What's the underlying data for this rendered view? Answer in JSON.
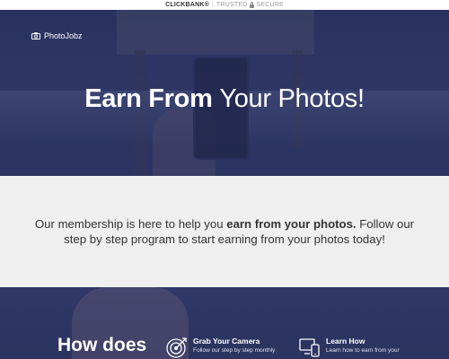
{
  "topbar": {
    "brand": "CLICKBANK",
    "sup": "®",
    "separator": "|",
    "trusted": "TRUSTED",
    "secure": "SECURE"
  },
  "hero": {
    "logo_text": "PhotoJobz",
    "title_bold": "Earn From",
    "title_light": "Your Photos!"
  },
  "membership": {
    "text_before": "Our membership is here to help you ",
    "text_bold": "earn from your photos.",
    "text_after": " Follow our step by step program to start earning from your photos today!"
  },
  "how": {
    "title": "How does",
    "steps": [
      {
        "icon": "target-icon",
        "title": "Grab Your Camera",
        "desc": "Follow our step by step monthly"
      },
      {
        "icon": "devices-icon",
        "title": "Learn How",
        "desc": "Learn how to earn from your"
      }
    ]
  },
  "colors": {
    "hero_overlay": "#2b3460",
    "band_bg": "#efefef",
    "text_dark": "#333333",
    "white": "#ffffff"
  }
}
